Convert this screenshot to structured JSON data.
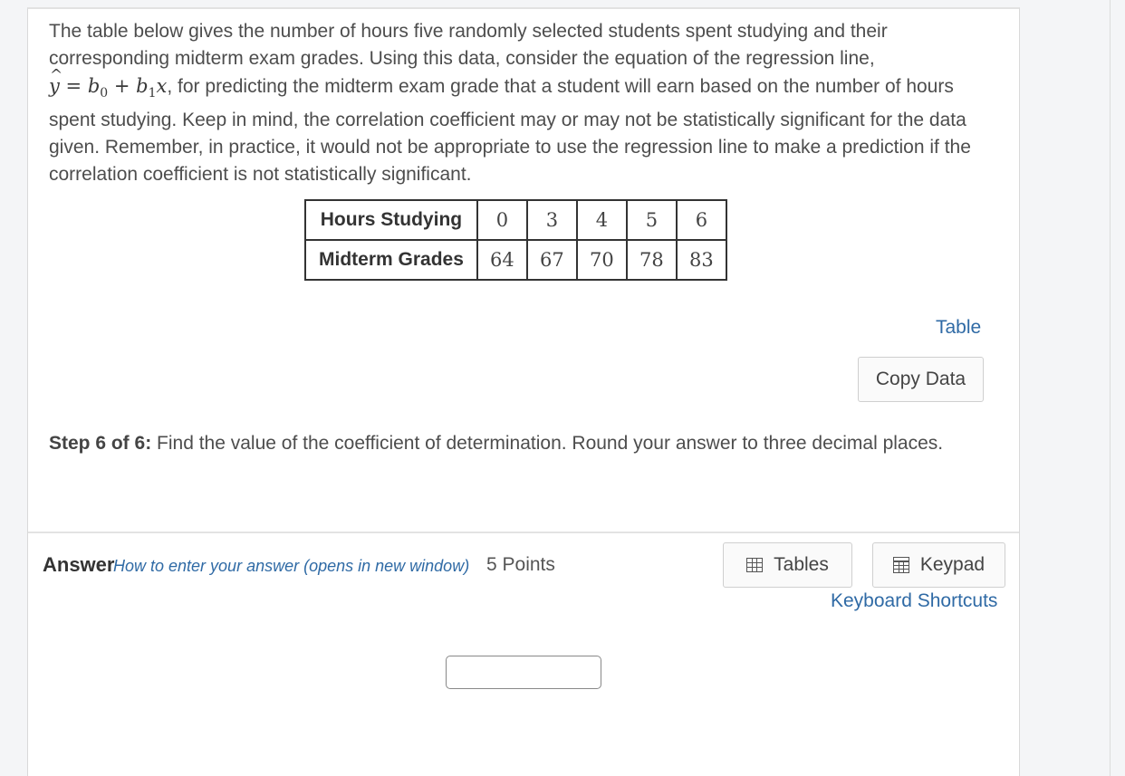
{
  "problem": {
    "line1": "The table below gives the number of hours five randomly selected students spent studying and their corresponding midterm exam grades. Using this data, consider the equation of the regression line,",
    "eq": {
      "yhat": "y",
      "equals": " = ",
      "b": "b",
      "sub0": "0",
      "plus": " + ",
      "sub1": "1",
      "x": "x"
    },
    "line2": ", for predicting the midterm exam grade that a student will earn based on the number of hours spent studying. Keep in mind, the correlation coefficient may or may not be statistically significant for the data given. Remember, in practice, it would not be appropriate to use the regression line to make a prediction if the correlation coefficient is not statistically significant."
  },
  "table": {
    "row1_header": "Hours Studying",
    "row1": [
      "0",
      "3",
      "4",
      "5",
      "6"
    ],
    "row2_header": "Midterm Grades",
    "row2": [
      "64",
      "67",
      "70",
      "78",
      "83"
    ]
  },
  "links": {
    "table": "Table",
    "copy_data": "Copy Data"
  },
  "step": {
    "label": "Step 6 of 6:",
    "text": " Find the value of the coefficient of determination. Round your answer to three decimal places."
  },
  "answer": {
    "label": "Answer",
    "howto": "How to enter your answer (opens in new window)",
    "points": "5 Points",
    "tables_btn": "Tables",
    "keypad_btn": "Keypad",
    "shortcuts": "Keyboard Shortcuts",
    "value": ""
  },
  "colors": {
    "link": "#2f6aa5",
    "text": "#4d4d4d",
    "background": "#f4f5f7"
  }
}
